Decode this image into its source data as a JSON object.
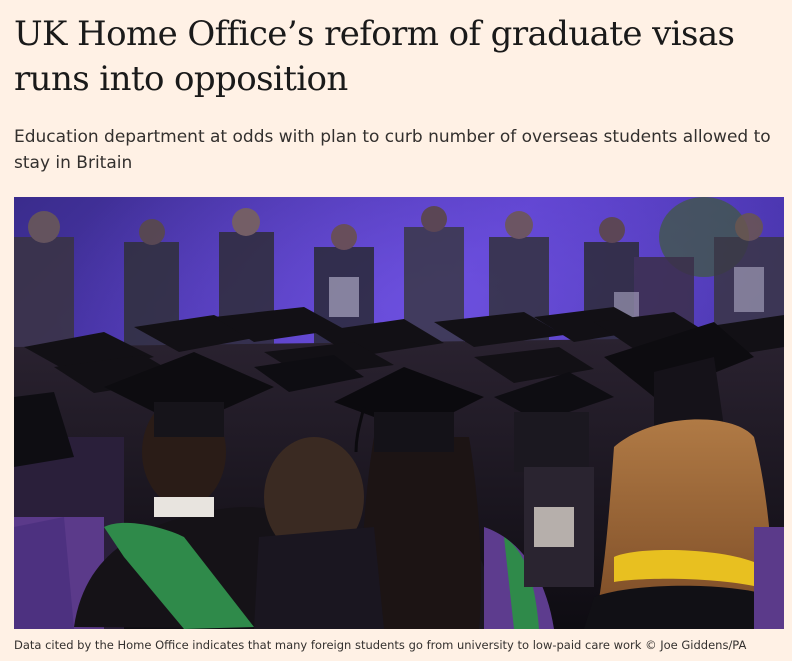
{
  "article": {
    "headline": "UK Home Office’s reform of graduate visas runs into opposition",
    "standfirst": "Education department at odds with plan to curb number of overseas students allowed to stay in Britain",
    "image": {
      "subject": "graduation-ceremony-photo",
      "caption": "Data cited by the Home Office indicates that many foreign students go from university to low-paid care work © Joe Giddens/PA"
    }
  },
  "colors": {
    "page_background": "#fff1e5",
    "headline_text": "#1a1a1a",
    "body_text": "#33302e",
    "backdrop_purple": "#3d2a9e"
  }
}
